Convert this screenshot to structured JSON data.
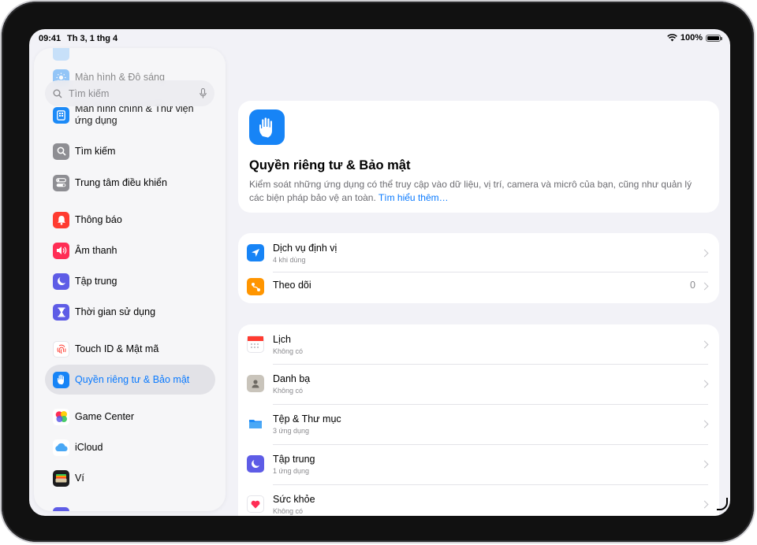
{
  "status": {
    "time": "09:41",
    "date": "Th 3, 1 thg 4",
    "battery": "100%",
    "battery_level": 1.0
  },
  "search": {
    "placeholder": "Tìm kiếm"
  },
  "sidebar": {
    "partial_items": [
      {
        "label": "Màn hình & Độ sáng",
        "icon": "brightness-icon",
        "color": "#1c8af7"
      }
    ],
    "items": [
      {
        "label": "Màn hình chính & Thư viện ứng dụng",
        "icon": "home-screen-icon",
        "color": "#1c8af7"
      },
      {
        "label": "Tìm kiếm",
        "icon": "search-icon",
        "color": "#8e8e93"
      },
      {
        "label": "Trung tâm điều khiển",
        "icon": "control-center-icon",
        "color": "#8e8e93"
      },
      {
        "label": "Thông báo",
        "icon": "bell-icon",
        "color": "#ff3b30"
      },
      {
        "label": "Âm thanh",
        "icon": "speaker-icon",
        "color": "#ff2d55"
      },
      {
        "label": "Tập trung",
        "icon": "moon-icon",
        "color": "#5e5ce6"
      },
      {
        "label": "Thời gian sử dụng",
        "icon": "hourglass-icon",
        "color": "#5e5ce6"
      },
      {
        "label": "Touch ID & Mật mã",
        "icon": "fingerprint-icon",
        "color": "#ffffff"
      },
      {
        "label": "Quyền riêng tư & Bảo mật",
        "icon": "hand-icon",
        "color": "#1784f6",
        "selected": true
      },
      {
        "label": "Game Center",
        "icon": "game-center-icon",
        "color": "#ffffff"
      },
      {
        "label": "iCloud",
        "icon": "cloud-icon",
        "color": "#ffffff"
      },
      {
        "label": "Ví",
        "icon": "wallet-icon",
        "color": "#1c1c1e"
      }
    ]
  },
  "hero": {
    "title": "Quyền riêng tư & Bảo mật",
    "description": "Kiểm soát những ứng dụng có thể truy cập vào dữ liệu, vị trí, camera và micrô của bạn, cũng như quản lý các biện pháp bảo vệ an toàn.",
    "link": "Tìm hiểu thêm…"
  },
  "group1": [
    {
      "title": "Dịch vụ định vị",
      "subtitle": "4 khi dùng",
      "icon": "location-icon",
      "color": "#1784f6"
    },
    {
      "title": "Theo dõi",
      "value": "0",
      "icon": "tracking-icon",
      "color": "#ff9500"
    }
  ],
  "group2": [
    {
      "title": "Lịch",
      "subtitle": "Không có",
      "icon": "calendar-icon"
    },
    {
      "title": "Danh bạ",
      "subtitle": "Không có",
      "icon": "contacts-icon"
    },
    {
      "title": "Tệp & Thư mục",
      "subtitle": "3 ứng dụng",
      "icon": "folder-icon"
    },
    {
      "title": "Tập trung",
      "subtitle": "1 ứng dụng",
      "icon": "moon-icon"
    },
    {
      "title": "Sức khỏe",
      "subtitle": "Không có",
      "icon": "health-icon"
    }
  ]
}
